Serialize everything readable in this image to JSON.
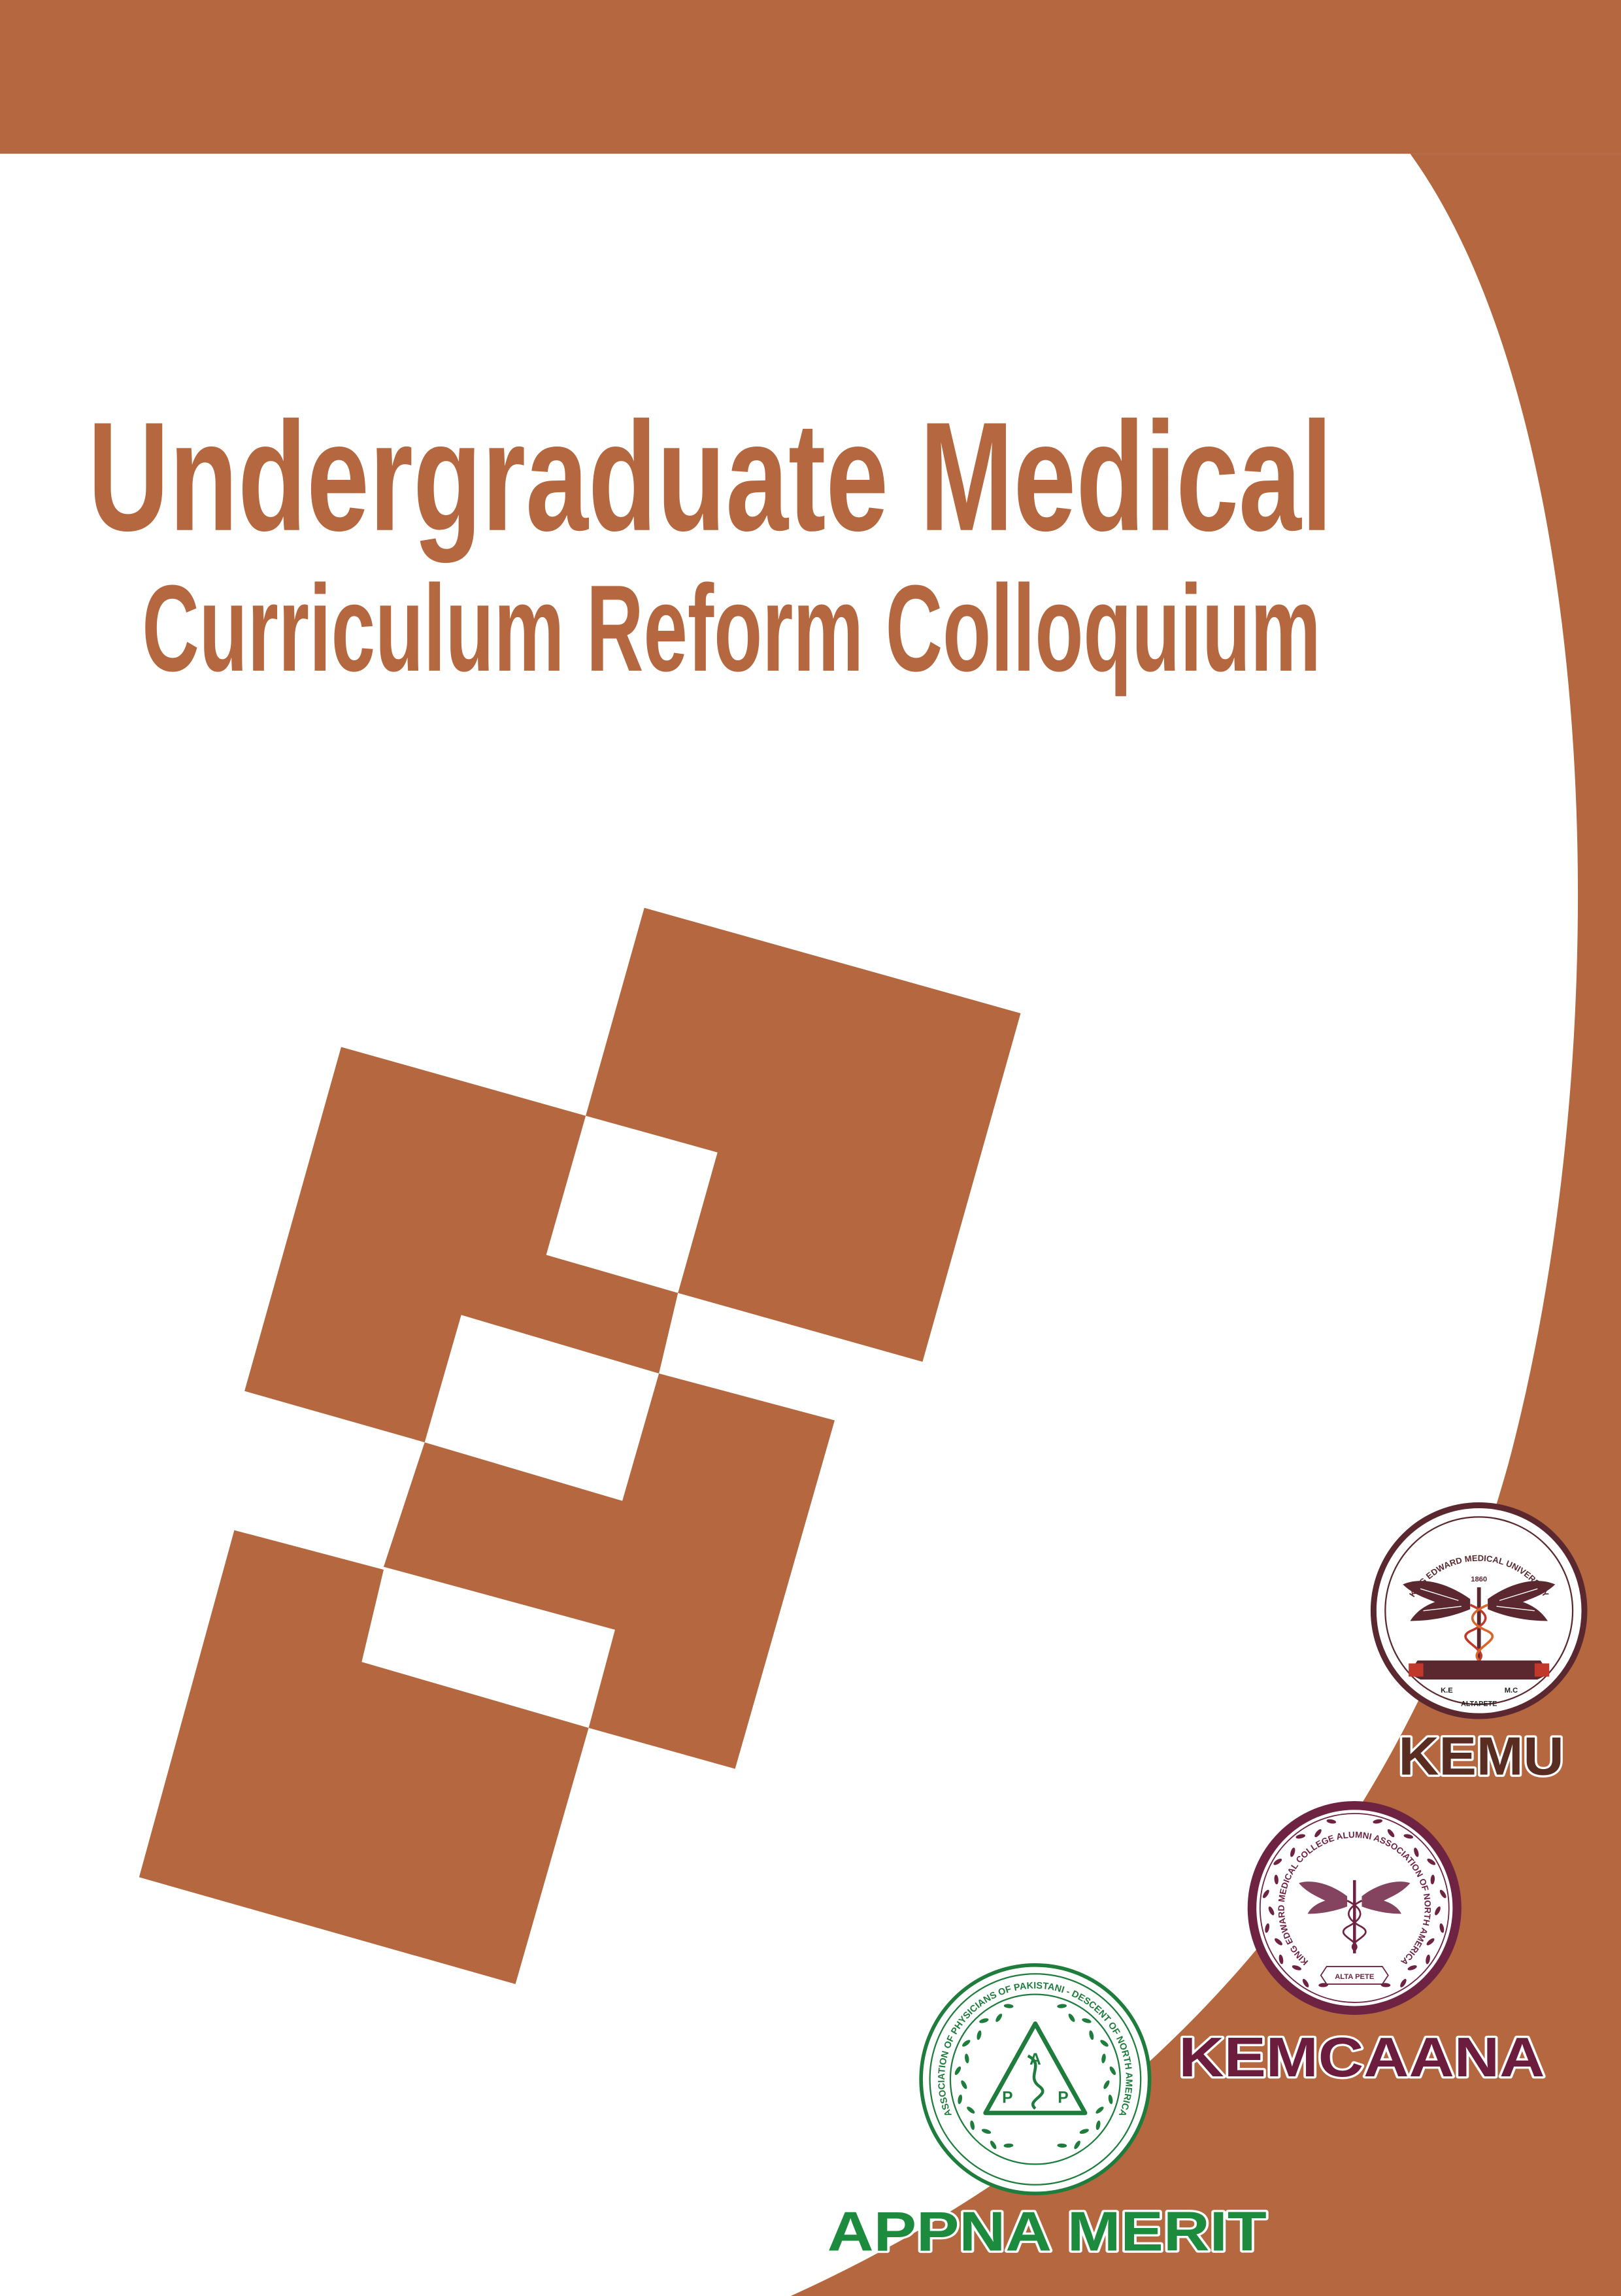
{
  "title": {
    "line1": "Undergraduate Medical",
    "line2": "Curriculum Reform Colloquium"
  },
  "colors": {
    "brand": "#B5683F",
    "background": "#FFFFFF",
    "kemu": "#5B2830",
    "kemcaana": "#6E2343",
    "appna": "#1E7D3C"
  },
  "logos": {
    "kemu": {
      "label": "KEMU",
      "ring_text": "KING EDWARD MEDICAL UNIVERSITY",
      "year": "1860",
      "banner_left": "K.E",
      "banner_right": "M.C",
      "motto": "ALTAPETE",
      "icon": "winged-caduceus-icon"
    },
    "kemcaana": {
      "label": "KEMCAANA",
      "ring_text": "KING EDWARD MEDICAL COLLEGE ALUMNI ASSOCIATION OF NORTH AMERICA",
      "motto": "ALTA PETE",
      "icon": "winged-caduceus-icon"
    },
    "appna": {
      "label": "APPNA MERIT",
      "ring_text": "ASSOCIATION OF PHYSICIANS OF PAKISTANI - DESCENT OF NORTH AMERICA",
      "letter_top": "A",
      "letter_left": "P",
      "letter_right": "P",
      "icon": "triangle-caduceus-icon"
    }
  }
}
